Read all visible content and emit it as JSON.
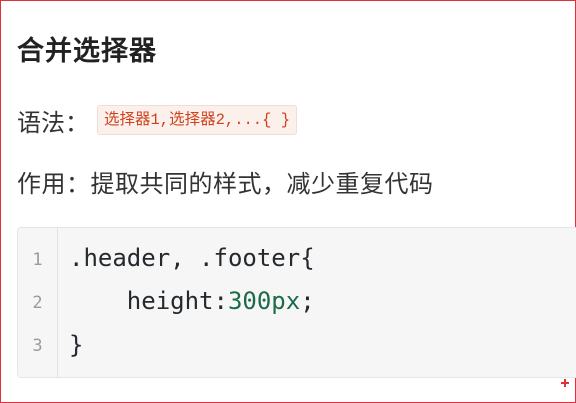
{
  "title": "合并选择器",
  "syntax": {
    "label": "语法：",
    "code": "选择器1,选择器2,...{ }"
  },
  "purpose": "作用：提取共同的样式，减少重复代码",
  "code_block": {
    "line_numbers": [
      "1",
      "2",
      "3"
    ],
    "lines": [
      {
        "text": ".header, .footer{"
      },
      {
        "prop": "    height:",
        "value": "300px",
        "end": ";"
      },
      {
        "text": "}"
      }
    ]
  },
  "colors": {
    "frame_border": "#e0303a",
    "inline_code_text": "#d0421b",
    "inline_code_bg": "#fbf0ec",
    "code_number": "#1c6b48"
  }
}
